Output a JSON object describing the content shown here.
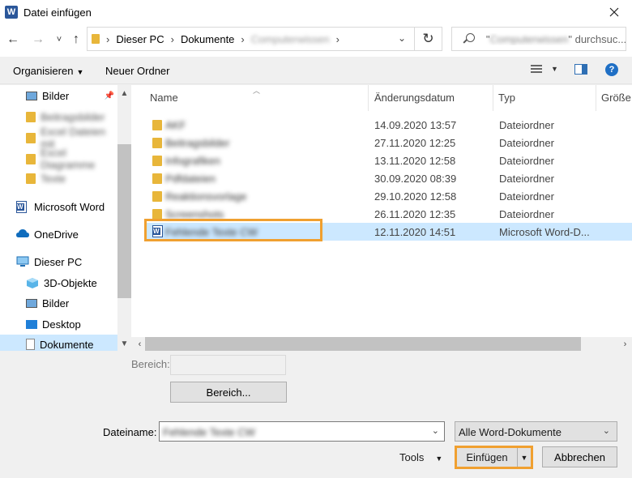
{
  "window": {
    "title": "Datei einfügen",
    "app_icon_letter": "W"
  },
  "navigation": {
    "back_icon": "←",
    "forward_icon": "→",
    "recent_icon": "˅",
    "up_icon": "↑"
  },
  "address": {
    "crumbs": [
      "Dieser PC",
      "Dokumente",
      "Computerwissen"
    ],
    "dropdown_icon": "⌄",
    "refresh_icon": "↻"
  },
  "search": {
    "placeholder_prefix": "\"",
    "placeholder_blurred": "Computerwissen",
    "placeholder_suffix": "\" durchsuc..."
  },
  "toolbar": {
    "organize_label": "Organisieren",
    "new_folder_label": "Neuer Ordner",
    "help_label": "?"
  },
  "sidebar": {
    "items": [
      {
        "label": "Bilder",
        "icon": "pictures-icon",
        "pinned": true
      },
      {
        "label": "Beitragsbilder",
        "icon": "folder-icon",
        "blurred": true
      },
      {
        "label": "Excel Dateien mit",
        "icon": "folder-icon",
        "blurred": true
      },
      {
        "label": "Excel Diagramme",
        "icon": "folder-icon",
        "blurred": true
      },
      {
        "label": "Texte",
        "icon": "folder-icon",
        "blurred": true
      },
      {
        "label": "Microsoft Word",
        "icon": "word-icon"
      },
      {
        "label": "OneDrive",
        "icon": "cloud-icon"
      },
      {
        "label": "Dieser PC",
        "icon": "pc-icon"
      },
      {
        "label": "3D-Objekte",
        "icon": "cube-icon"
      },
      {
        "label": "Bilder",
        "icon": "pictures-icon"
      },
      {
        "label": "Desktop",
        "icon": "desktop-icon"
      },
      {
        "label": "Dokumente",
        "icon": "documents-icon",
        "selected": true
      }
    ]
  },
  "columns": {
    "name": "Name",
    "date": "Änderungsdatum",
    "type": "Typ",
    "size": "Größe"
  },
  "files": [
    {
      "name": "AKF",
      "date": "14.09.2020 13:57",
      "type": "Dateiordner",
      "kind": "folder"
    },
    {
      "name": "Beitragsbilder",
      "date": "27.11.2020 12:25",
      "type": "Dateiordner",
      "kind": "folder"
    },
    {
      "name": "Infografiken",
      "date": "13.11.2020 12:58",
      "type": "Dateiordner",
      "kind": "folder"
    },
    {
      "name": "Pdfdateien",
      "date": "30.09.2020 08:39",
      "type": "Dateiordner",
      "kind": "folder"
    },
    {
      "name": "Reaktionsvorlage",
      "date": "29.10.2020 12:58",
      "type": "Dateiordner",
      "kind": "folder"
    },
    {
      "name": "Screenshots",
      "date": "26.11.2020 12:35",
      "type": "Dateiordner",
      "kind": "folder"
    },
    {
      "name": "Fehlende Texte CW",
      "date": "12.11.2020 14:51",
      "type": "Microsoft Word-D...",
      "kind": "word",
      "selected": true
    }
  ],
  "bottom": {
    "range_label": "Bereich:",
    "range_button": "Bereich...",
    "filename_label": "Dateiname:",
    "filename_value": "Fehlende Texte CW",
    "filter_value": "Alle Word-Dokumente",
    "tools_label": "Tools",
    "insert_label": "Einfügen",
    "cancel_label": "Abbrechen"
  },
  "colors": {
    "selection": "#cce8ff",
    "highlight": "#f0a030",
    "word_blue": "#2b579a",
    "folder": "#e8b63a"
  }
}
